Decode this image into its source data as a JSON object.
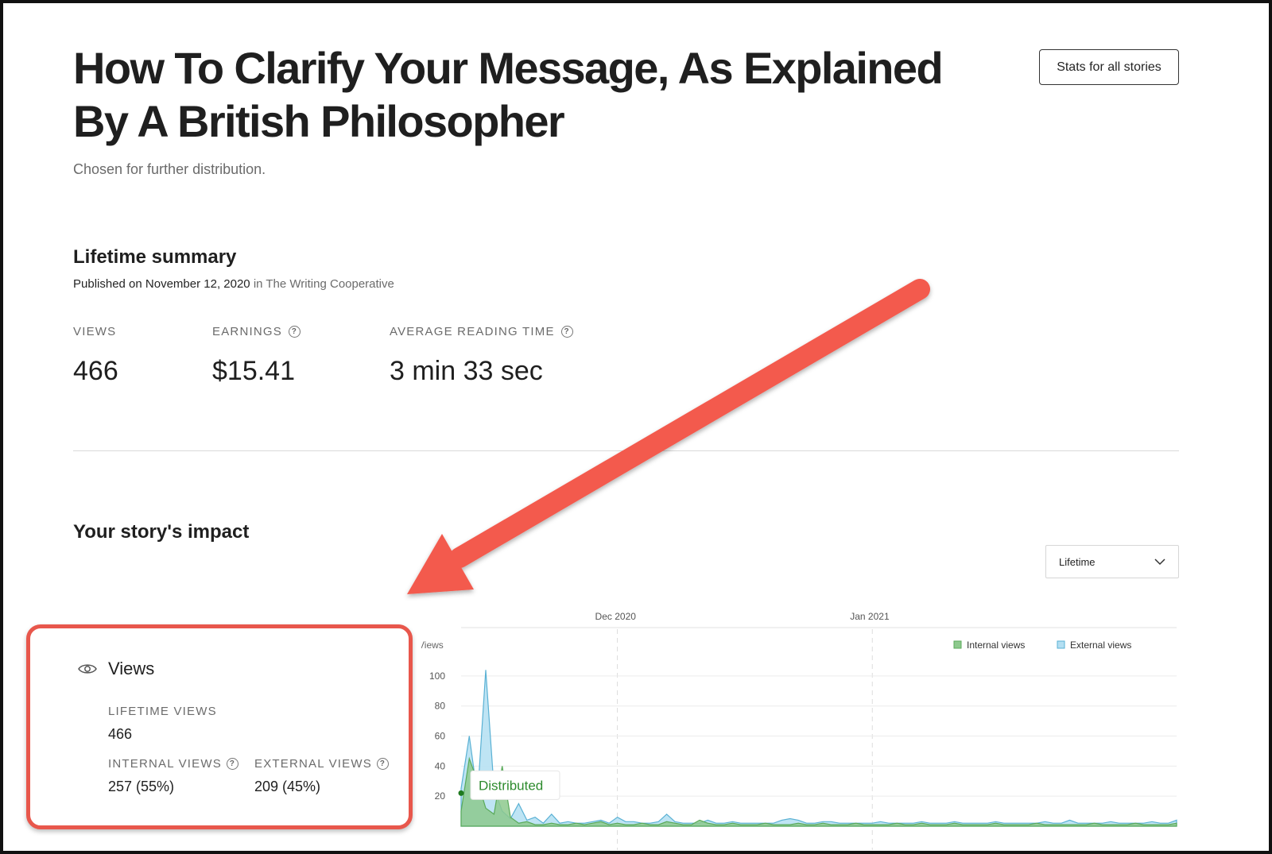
{
  "story": {
    "title": "How To Clarify Your Message, As Explained By A British Philosopher",
    "subtitle": "Chosen for further distribution.",
    "stats_button": "Stats for all stories"
  },
  "summary": {
    "heading": "Lifetime summary",
    "published_prefix": "Published on November 12, 2020",
    "published_in": "in The Writing Cooperative",
    "metrics": [
      {
        "label": "VIEWS",
        "value": "466",
        "has_help": false
      },
      {
        "label": "EARNINGS",
        "value": "$15.41",
        "has_help": true
      },
      {
        "label": "AVERAGE READING TIME",
        "value": "3 min 33 sec",
        "has_help": true
      }
    ]
  },
  "impact": {
    "heading": "Your story's impact",
    "range_select": {
      "value": "Lifetime"
    },
    "views_card": {
      "title": "Views",
      "lifetime_label": "LIFETIME VIEWS",
      "lifetime_value": "466",
      "internal_label": "INTERNAL VIEWS",
      "internal_value": "257 (55%)",
      "external_label": "EXTERNAL VIEWS",
      "external_value": "209 (45%)"
    }
  },
  "colors": {
    "annotation_red": "#e8574c",
    "internal_views": "#8dc98d",
    "external_views": "#b3dff2"
  },
  "chart_data": {
    "type": "area",
    "ylabel": "Views",
    "month_labels": [
      "Dec 2020",
      "Jan 2021"
    ],
    "month_label_day_index": [
      19,
      50
    ],
    "yticks": [
      20,
      40,
      60,
      80,
      100
    ],
    "ylim": [
      0,
      110
    ],
    "grid": true,
    "legend_position": "top-right",
    "annotation": {
      "text": "Distributed",
      "day_index": 0,
      "value": 22
    },
    "series": [
      {
        "name": "Internal views",
        "color": "#5aaa5a",
        "fill": "#8dc98d",
        "values": [
          10,
          45,
          30,
          12,
          8,
          40,
          6,
          2,
          3,
          1,
          1,
          2,
          1,
          1,
          2,
          1,
          2,
          3,
          1,
          2,
          1,
          1,
          2,
          1,
          1,
          3,
          2,
          1,
          1,
          4,
          2,
          1,
          1,
          2,
          1,
          1,
          1,
          2,
          1,
          1,
          1,
          2,
          1,
          1,
          2,
          1,
          1,
          1,
          2,
          1,
          1,
          1,
          1,
          2,
          1,
          1,
          2,
          1,
          1,
          1,
          2,
          1,
          1,
          1,
          1,
          2,
          1,
          1,
          1,
          1,
          2,
          1,
          1,
          1,
          1,
          1,
          1,
          2,
          1,
          1,
          1,
          1,
          2,
          1,
          1,
          1,
          1,
          2
        ]
      },
      {
        "name": "External views",
        "color": "#5ab1d4",
        "fill": "#b3dff2",
        "values": [
          25,
          60,
          20,
          104,
          25,
          10,
          5,
          15,
          4,
          6,
          2,
          8,
          2,
          3,
          2,
          2,
          3,
          4,
          2,
          6,
          3,
          3,
          2,
          2,
          3,
          8,
          3,
          2,
          2,
          2,
          4,
          2,
          2,
          3,
          2,
          2,
          2,
          2,
          2,
          4,
          5,
          4,
          2,
          2,
          3,
          3,
          2,
          2,
          2,
          2,
          2,
          3,
          2,
          2,
          2,
          2,
          3,
          2,
          2,
          2,
          3,
          2,
          2,
          2,
          2,
          3,
          2,
          2,
          2,
          2,
          2,
          3,
          2,
          2,
          4,
          2,
          2,
          2,
          2,
          3,
          2,
          2,
          2,
          2,
          3,
          2,
          2,
          4
        ]
      }
    ]
  }
}
